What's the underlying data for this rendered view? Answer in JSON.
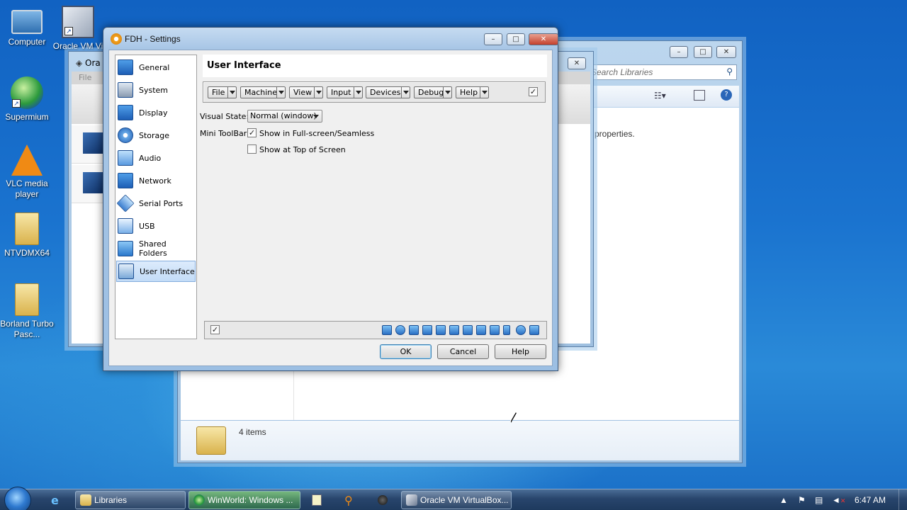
{
  "desktop": {
    "icons": [
      {
        "label": "Computer",
        "icon": "computer-icon"
      },
      {
        "label": "Oracle VM Vi",
        "icon": "virtualbox-icon"
      },
      {
        "label": "Supermium",
        "icon": "supermium-icon"
      },
      {
        "label": "VLC media player",
        "icon": "vlc-icon"
      },
      {
        "label": "NTVDMX64",
        "icon": "folder-icon"
      },
      {
        "label": "Borland Turbo Pasc...",
        "icon": "folder-icon"
      }
    ]
  },
  "explorer": {
    "search_placeholder": "Search Libraries",
    "partial_text": "properties.",
    "status": "4 items"
  },
  "virtualbox_manager": {
    "title": "Ora",
    "menu_partial": "File"
  },
  "dialog": {
    "title": "FDH - Settings",
    "nav_items": [
      {
        "label": "General",
        "icon": "general-icon"
      },
      {
        "label": "System",
        "icon": "system-icon"
      },
      {
        "label": "Display",
        "icon": "display-icon"
      },
      {
        "label": "Storage",
        "icon": "storage-icon"
      },
      {
        "label": "Audio",
        "icon": "audio-icon"
      },
      {
        "label": "Network",
        "icon": "network-icon"
      },
      {
        "label": "Serial Ports",
        "icon": "serial-ports-icon"
      },
      {
        "label": "USB",
        "icon": "usb-icon"
      },
      {
        "label": "Shared Folders",
        "icon": "shared-folders-icon"
      },
      {
        "label": "User Interface",
        "icon": "user-interface-icon"
      }
    ],
    "selected": "User Interface",
    "page_title": "User Interface",
    "menubar_items": [
      "File",
      "Machine",
      "View",
      "Input",
      "Devices",
      "Debug",
      "Help"
    ],
    "menubar_enabled": true,
    "visual_state_label": "Visual State:",
    "visual_state_value": "Normal (window)",
    "mini_toolbar_label": "Mini ToolBar:",
    "show_fullscreen_label": "Show in Full-screen/Seamless",
    "show_fullscreen_checked": true,
    "show_top_label": "Show at Top of Screen",
    "show_top_checked": false,
    "statusbar_enabled": true,
    "statusbar_icons": [
      "hard-disk-icon",
      "optical-disk-icon",
      "floppy-icon",
      "audio-icon",
      "network-icon",
      "usb-icon",
      "shared-folder-icon",
      "display-icon",
      "recording-icon",
      "video-capture-icon",
      "cpu-icon",
      "mouse-integration-icon",
      "keyboard-icon"
    ],
    "buttons": {
      "ok": "OK",
      "cancel": "Cancel",
      "help": "Help"
    }
  },
  "taskbar": {
    "items": [
      {
        "label": "Libraries",
        "icon": "explorer-icon"
      },
      {
        "label": "WinWorld: Windows ...",
        "icon": "browser-icon"
      },
      {
        "label": "Oracle VM VirtualBox...",
        "icon": "virtualbox-icon"
      }
    ],
    "clock": "6:47 AM"
  }
}
